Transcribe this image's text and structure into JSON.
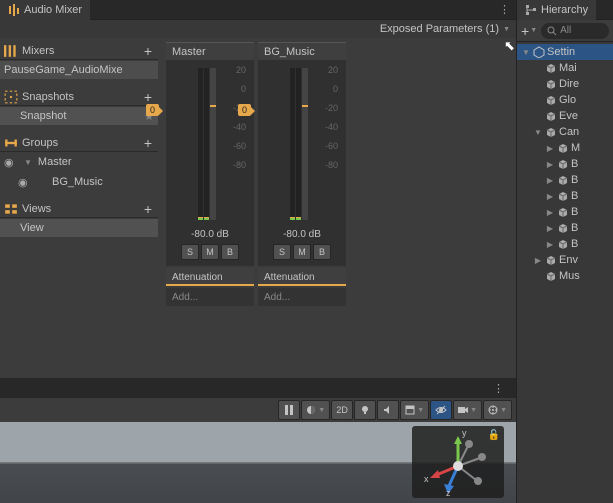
{
  "audioMixer": {
    "tabTitle": "Audio Mixer",
    "exposedParams": "Exposed Parameters (1)",
    "sections": {
      "mixers": {
        "title": "Mixers",
        "items": [
          "PauseGame_AudioMixe"
        ]
      },
      "snapshots": {
        "title": "Snapshots",
        "items": [
          "Snapshot"
        ]
      },
      "groups": {
        "title": "Groups",
        "items": [
          "Master",
          "BG_Music"
        ]
      },
      "views": {
        "title": "Views",
        "items": [
          "View"
        ]
      }
    },
    "channels": [
      {
        "name": "Master",
        "marker": "0",
        "db": "-80.0 dB",
        "buttons": [
          "S",
          "M",
          "B"
        ],
        "effect": "Attenuation",
        "add": "Add..."
      },
      {
        "name": "BG_Music",
        "marker": "0",
        "db": "-80.0 dB",
        "buttons": [
          "S",
          "M",
          "B"
        ],
        "effect": "Attenuation",
        "add": "Add..."
      }
    ],
    "scaleLabels": [
      "20",
      "0",
      "-20",
      "-40",
      "-60",
      "-80"
    ]
  },
  "hierarchy": {
    "tabTitle": "Hierarchy",
    "searchPlaceholder": "All",
    "items": [
      {
        "label": "Settin",
        "depth": 0,
        "root": true,
        "foldout": "▼"
      },
      {
        "label": "Mai",
        "depth": 1,
        "foldout": ""
      },
      {
        "label": "Dire",
        "depth": 1,
        "foldout": ""
      },
      {
        "label": "Glo",
        "depth": 1,
        "foldout": ""
      },
      {
        "label": "Eve",
        "depth": 1,
        "foldout": ""
      },
      {
        "label": "Can",
        "depth": 1,
        "foldout": "▼"
      },
      {
        "label": "M",
        "depth": 2,
        "foldout": "▶"
      },
      {
        "label": "B",
        "depth": 2,
        "foldout": "▶"
      },
      {
        "label": "B",
        "depth": 2,
        "foldout": "▶"
      },
      {
        "label": "B",
        "depth": 2,
        "foldout": "▶"
      },
      {
        "label": "B",
        "depth": 2,
        "foldout": "▶"
      },
      {
        "label": "B",
        "depth": 2,
        "foldout": "▶"
      },
      {
        "label": "B",
        "depth": 2,
        "foldout": "▶"
      },
      {
        "label": "Env",
        "depth": 1,
        "foldout": "▶"
      },
      {
        "label": "Mus",
        "depth": 1,
        "foldout": ""
      }
    ]
  },
  "sceneToolbar": {
    "twoD": "2D"
  },
  "gizmo": {
    "x": "x",
    "y": "y",
    "z": "z"
  },
  "colors": {
    "accent": "#e6a84a",
    "selection": "#2c5586",
    "axisX": "#d64545",
    "axisY": "#7bc74c",
    "axisZ": "#3a7fd6"
  }
}
